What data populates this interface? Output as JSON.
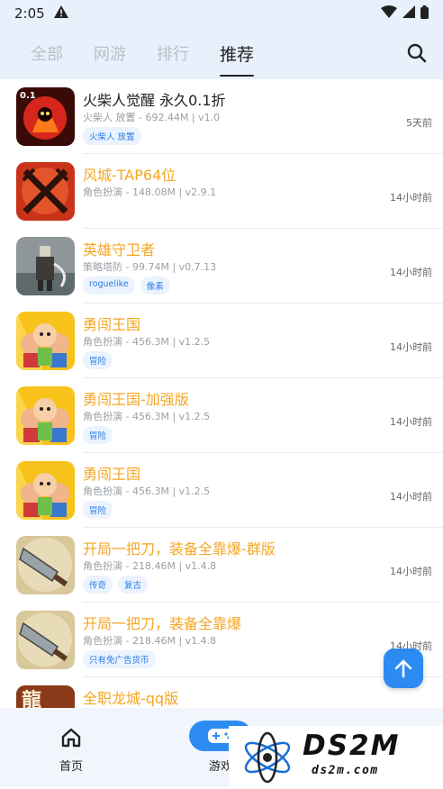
{
  "status": {
    "time": "2:05"
  },
  "tabs": [
    {
      "label": "全部"
    },
    {
      "label": "网游"
    },
    {
      "label": "排行"
    },
    {
      "label": "推荐"
    }
  ],
  "colors": {
    "accent": "#2b8bf2",
    "title": "#f5a623",
    "tag_bg": "#eaf3fe",
    "tag_text": "#2d7be5"
  },
  "games": [
    {
      "title": "火柴人觉醒 永久0.1折",
      "meta": "火柴人 放置 - 692.44M | v1.0",
      "tags": [
        "火柴人 放置"
      ],
      "time": "5天前",
      "icon": "flame-hero-icon"
    },
    {
      "title": "风城-TAP64位",
      "meta": "角色扮演 - 148.08M | v2.9.1",
      "tags": [],
      "time": "14小时前",
      "icon": "crossed-swords-icon"
    },
    {
      "title": "英雄守卫者",
      "meta": "策略塔防 - 99.74M | v0.7.13",
      "tags": [
        "roguelike",
        "像素"
      ],
      "time": "14小时前",
      "icon": "pixel-warrior-icon"
    },
    {
      "title": "勇闯王国",
      "meta": "角色扮演 - 456.3M | v1.2.5",
      "tags": [
        "冒险"
      ],
      "time": "14小时前",
      "icon": "cartoon-heroes-icon"
    },
    {
      "title": "勇闯王国-加强版",
      "meta": "角色扮演 - 456.3M | v1.2.5",
      "tags": [
        "冒险"
      ],
      "time": "14小时前",
      "icon": "cartoon-heroes-icon"
    },
    {
      "title": "勇闯王国",
      "meta": "角色扮演 - 456.3M | v1.2.5",
      "tags": [
        "冒险"
      ],
      "time": "14小时前",
      "icon": "cartoon-heroes-icon"
    },
    {
      "title": "开局一把刀，装备全靠爆-群版",
      "meta": "角色扮演 - 218.46M | v1.4.8",
      "tags": [
        "传奇",
        "复古"
      ],
      "time": "14小时前",
      "icon": "cleaver-icon"
    },
    {
      "title": "开局一把刀，装备全靠爆",
      "meta": "角色扮演 - 218.46M | v1.4.8",
      "tags": [
        "只有免广告货币"
      ],
      "time": "14小时前",
      "icon": "cleaver-icon"
    },
    {
      "title": "全职龙城-qq版",
      "meta": "",
      "tags": [],
      "time": "",
      "icon": "dragon-character-icon"
    }
  ],
  "nav": {
    "home": "首页",
    "games": "游戏"
  },
  "watermark": {
    "brand": "DS2M",
    "site": "ds2m.com"
  }
}
